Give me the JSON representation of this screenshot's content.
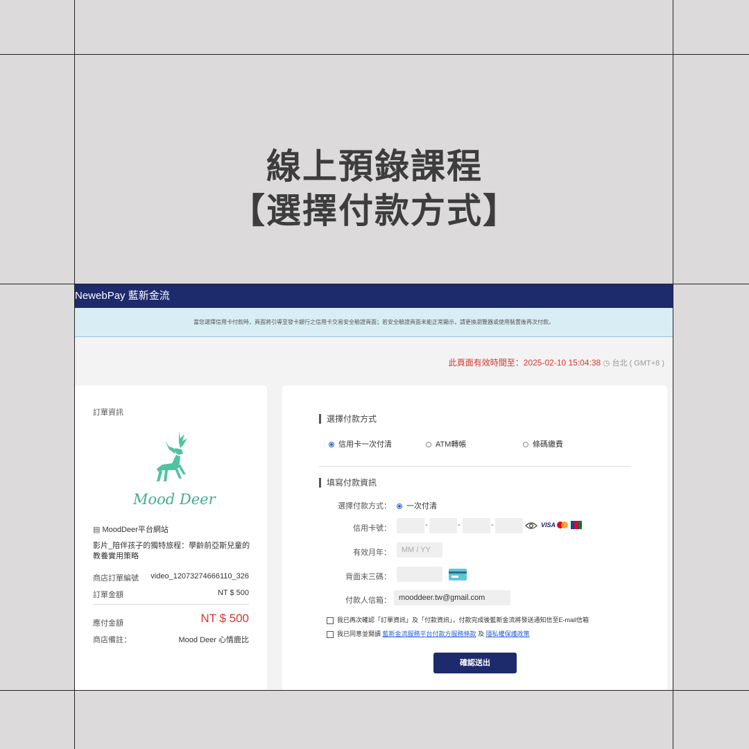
{
  "slide": {
    "title_line1": "線上預錄課程",
    "title_line2": "【選擇付款方式】"
  },
  "header": {
    "brand": "NewebPay 藍新金流"
  },
  "notice": "當您選擇信用卡付款時，頁面將引導至發卡銀行之信用卡交易安全驗證頁面；若安全驗證頁面未能正常顯示，請更換瀏覽器或使用裝置後再次付款。",
  "expiry": {
    "text": "此頁面有效時間至：2025-02-10 15:04:38",
    "timezone": "台北 ( GMT+8 )"
  },
  "order": {
    "heading": "訂單資訊",
    "logo_text": "Mood Deer",
    "shop_name": "MoodDeer平台網站",
    "product": "影片_陪伴孩子的獨特旅程：學齡前亞斯兒童的教養實用策略",
    "order_no_label": "商店訂單編號",
    "order_no": "video_12073274666110_326",
    "amount_label": "訂單金額",
    "amount": "NT $ 500",
    "payable_label": "應付金額",
    "payable": "NT $ 500",
    "note_label": "商店備註：",
    "note": "Mood Deer 心情鹿比"
  },
  "payment": {
    "method_heading": "選擇付款方式",
    "methods": [
      "信用卡一次付清",
      "ATM轉帳",
      "條碼繳費"
    ],
    "fill_heading": "填寫付款資訊",
    "type_label": "選擇付款方式：",
    "type_value": "一次付清",
    "card_label": "信用卡號：",
    "expiry_label": "有效月年：",
    "expiry_placeholder": "MM  /  YY",
    "cvv_label": "背面末三碼：",
    "email_label": "付款人信箱：",
    "email_value": "mooddeer.tw@gmail.com",
    "confirm_text": "我已再次確認「訂單資訊」及「付款資訊」，付款完成後藍新金流將發送通知信至E-mail信箱",
    "agree_prefix": "我已同意並閱讀",
    "terms_link": "藍新金流服務平台付款方服務條款",
    "agree_and": "及",
    "privacy_link": "隱私權保護政策",
    "submit": "確認送出",
    "card_brands": [
      "VISA",
      "mastercard",
      "JCB"
    ]
  }
}
